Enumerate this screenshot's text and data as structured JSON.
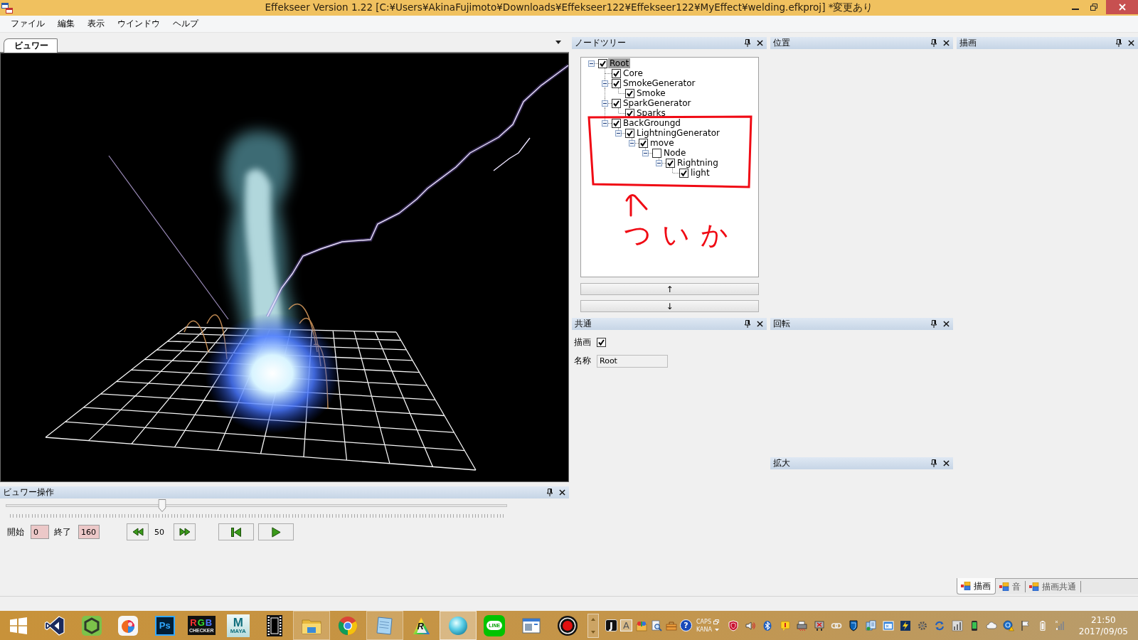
{
  "window": {
    "title": "Effekseer Version 1.22 [C:¥Users¥AkinaFujimoto¥Downloads¥Effekseer122¥Effekseer122¥MyEffect¥welding.efkproj] *変更あり"
  },
  "menu": [
    "ファイル",
    "編集",
    "表示",
    "ウインドウ",
    "ヘルプ"
  ],
  "viewer": {
    "tab": {
      "label": "ビュワー",
      "selected": true
    }
  },
  "viewer_controls": {
    "title": "ビュワー操作",
    "timeline": {
      "level": 0.3125
    },
    "start_label": "開始",
    "start_value": "0",
    "end_label": "終了",
    "end_value": "160",
    "frame": "50"
  },
  "node_tree": {
    "title": "ノードツリー",
    "nodes": [
      {
        "label": "Root",
        "checked": true,
        "selected": true,
        "expanded": true,
        "children": [
          {
            "label": "Core",
            "checked": true,
            "selected": false
          },
          {
            "label": "SmokeGenerator",
            "checked": true,
            "selected": false,
            "expanded": true,
            "children": [
              {
                "label": "Smoke",
                "checked": true,
                "selected": false
              }
            ]
          },
          {
            "label": "SparkGenerator",
            "checked": true,
            "selected": false,
            "expanded": true,
            "children": [
              {
                "label": "Sparks",
                "checked": true,
                "selected": false
              }
            ]
          },
          {
            "label": "BackGroungd",
            "checked": true,
            "selected": false,
            "expanded": true,
            "children": [
              {
                "label": "LightningGenerator",
                "checked": true,
                "selected": false,
                "expanded": true,
                "children": [
                  {
                    "label": "move",
                    "checked": true,
                    "selected": false,
                    "expanded": true,
                    "children": [
                      {
                        "label": "Node",
                        "checked": false,
                        "selected": false,
                        "expanded": true,
                        "children": [
                          {
                            "label": "Rightning",
                            "checked": true,
                            "selected": false,
                            "expanded": true,
                            "children": [
                              {
                                "label": "light",
                                "checked": true,
                                "selected": false
                              }
                            ]
                          }
                        ]
                      }
                    ]
                  }
                ]
              }
            ]
          }
        ]
      }
    ],
    "annotation": "ついか",
    "move_buttons": [
      "↑",
      "↓"
    ]
  },
  "position_panel": {
    "title": "位置"
  },
  "render_panel": {
    "title": "描画"
  },
  "common_panel": {
    "title": "共通",
    "fields": [
      {
        "kind": "checkbox",
        "label": "描画",
        "checked": true
      },
      {
        "kind": "text",
        "label": "名称",
        "value": "Root"
      }
    ]
  },
  "rotation_panel": {
    "title": "回転"
  },
  "scale_panel": {
    "title": "拡大"
  },
  "bottom_tabs": [
    {
      "label": "描画",
      "selected": true
    },
    {
      "label": "音",
      "selected": false
    },
    {
      "label": "描画共通",
      "selected": false
    }
  ],
  "taskbar": {
    "apps": [
      {
        "kind": "start",
        "open": false,
        "selected": false
      },
      {
        "kind": "bowtie",
        "open": false,
        "selected": false
      },
      {
        "kind": "hexagon",
        "open": false,
        "selected": false
      },
      {
        "kind": "drop",
        "open": false,
        "selected": false
      },
      {
        "kind": "ps",
        "text": "Ps",
        "open": false,
        "selected": false
      },
      {
        "kind": "rgb",
        "text": "RGB",
        "subtext": "CHECKER",
        "open": false,
        "selected": false
      },
      {
        "kind": "maya",
        "text": "M",
        "subtext": "MAYA",
        "open": false,
        "selected": false
      },
      {
        "kind": "film",
        "open": false,
        "selected": false
      },
      {
        "kind": "folder",
        "open": true,
        "selected": false
      },
      {
        "kind": "circle",
        "open": false,
        "selected": false
      },
      {
        "kind": "notepad",
        "open": true,
        "selected": false
      },
      {
        "kind": "triangle",
        "text": "R",
        "open": false,
        "selected": false
      },
      {
        "kind": "sphere",
        "open": true,
        "selected": true
      },
      {
        "kind": "chat",
        "text": "LINE",
        "open": false,
        "selected": false
      },
      {
        "kind": "window",
        "open": false,
        "selected": false
      },
      {
        "kind": "record",
        "open": false,
        "selected": false
      }
    ],
    "tray_left": [
      {
        "kind": "letter_dark",
        "text": "J"
      },
      {
        "kind": "letter_light",
        "text": "A"
      },
      {
        "kind": "paint_box"
      },
      {
        "kind": "doc_search"
      },
      {
        "kind": "toolbox"
      },
      {
        "kind": "help",
        "text": "?"
      }
    ],
    "ime": {
      "caps": "CAPS",
      "kana": "KANA"
    },
    "tray": [
      {
        "kind": "shield"
      },
      {
        "kind": "speaker"
      },
      {
        "kind": "bluetooth"
      },
      {
        "kind": "notice"
      },
      {
        "kind": "printer"
      },
      {
        "kind": "net_error"
      },
      {
        "kind": "link"
      },
      {
        "kind": "shield_dark"
      },
      {
        "kind": "docs"
      },
      {
        "kind": "window"
      },
      {
        "kind": "bolt"
      },
      {
        "kind": "gear"
      },
      {
        "kind": "sync"
      },
      {
        "kind": "chart"
      },
      {
        "kind": "phone"
      },
      {
        "kind": "cloud"
      },
      {
        "kind": "warning"
      },
      {
        "kind": "flag"
      },
      {
        "kind": "battery"
      },
      {
        "kind": "signal"
      }
    ],
    "time": "21:50",
    "date": "2017/09/05"
  }
}
